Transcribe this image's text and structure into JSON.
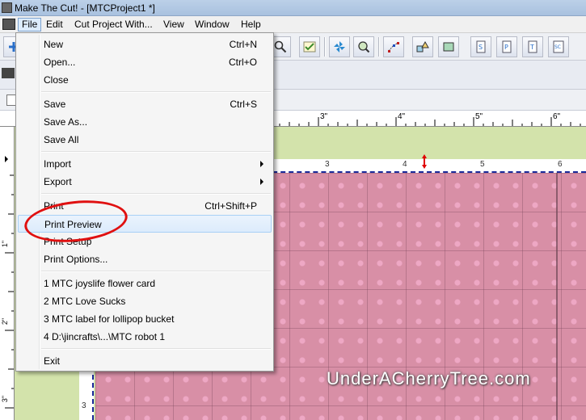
{
  "window": {
    "title": "Make The Cut! - [MTCProject1 *]"
  },
  "menubar": {
    "items": [
      {
        "label": "File"
      },
      {
        "label": "Edit"
      },
      {
        "label": "Cut Project With..."
      },
      {
        "label": "View"
      },
      {
        "label": "Window"
      },
      {
        "label": "Help"
      }
    ]
  },
  "file_menu": {
    "new": {
      "label": "New",
      "shortcut": "Ctrl+N"
    },
    "open": {
      "label": "Open...",
      "shortcut": "Ctrl+O"
    },
    "close": {
      "label": "Close"
    },
    "save": {
      "label": "Save",
      "shortcut": "Ctrl+S"
    },
    "save_as": {
      "label": "Save As..."
    },
    "save_all": {
      "label": "Save All"
    },
    "import": {
      "label": "Import"
    },
    "export": {
      "label": "Export"
    },
    "print": {
      "label": "Print",
      "shortcut": "Ctrl+Shift+P"
    },
    "print_preview": {
      "label": "Print Preview"
    },
    "print_setup": {
      "label": "Print Setup"
    },
    "print_options": {
      "label": "Print Options..."
    },
    "recent": [
      {
        "label": "1 MTC joyslife flower card"
      },
      {
        "label": "2 MTC Love Sucks"
      },
      {
        "label": "3 MTC label for lollipop bucket"
      },
      {
        "label": "4 D:\\jincrafts\\...\\MTC robot 1"
      }
    ],
    "exit": {
      "label": "Exit"
    }
  },
  "ruler": {
    "top_labels": [
      "3\"",
      "4\"",
      "5\"",
      "6\""
    ],
    "left_labels": [
      "1\"",
      "2\"",
      "3\""
    ]
  },
  "mat": {
    "top_numbers": [
      "3",
      "4",
      "5",
      "6"
    ],
    "left_number": "3"
  },
  "watermark": "UnderACherryTree.com",
  "colors": {
    "paper": "#d88fa6",
    "mat_green": "#d3e3ab",
    "highlight_circle": "#e01010"
  }
}
